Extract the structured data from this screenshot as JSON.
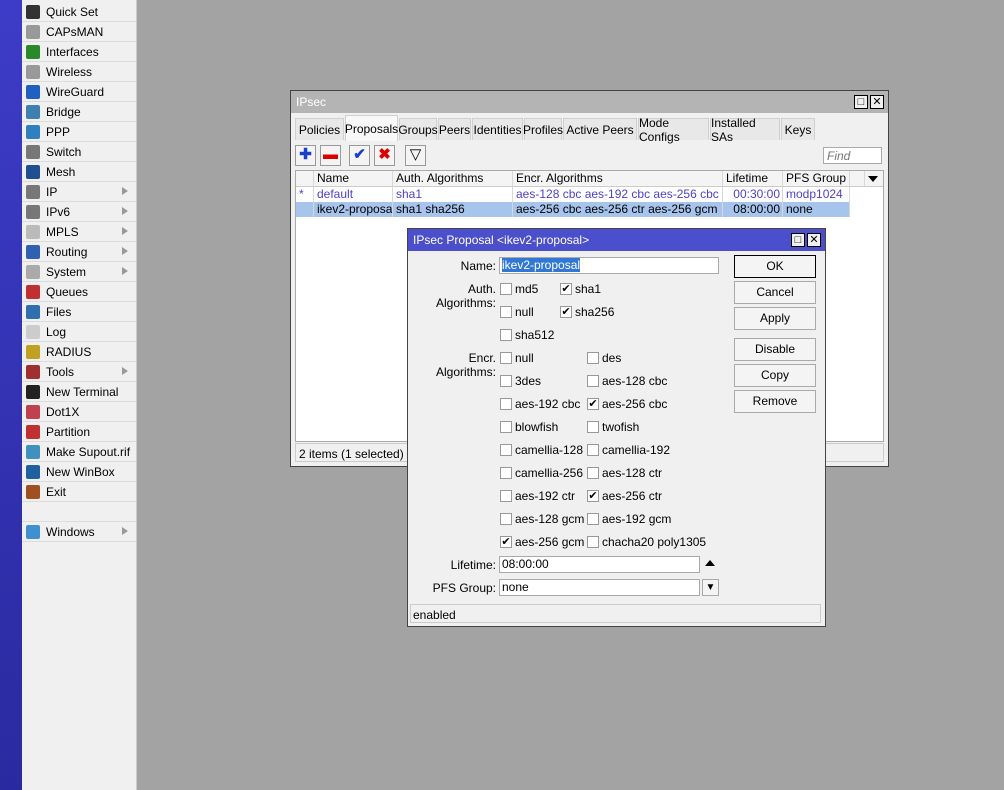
{
  "colors": {
    "accent_blue": "#4b4fcb",
    "selection": "#a7c5ec",
    "link_text": "#4f3fcb"
  },
  "sidebar": {
    "items": [
      {
        "label": "Quick Set",
        "icon": "wand-icon",
        "color": "#333",
        "submenu": false
      },
      {
        "label": "CAPsMAN",
        "icon": "antenna-icon",
        "color": "#999",
        "submenu": false
      },
      {
        "label": "Interfaces",
        "icon": "interface-card-icon",
        "color": "#2a8a2a",
        "submenu": false
      },
      {
        "label": "Wireless",
        "icon": "wireless-icon",
        "color": "#999",
        "submenu": false
      },
      {
        "label": "WireGuard",
        "icon": "wireguard-icon",
        "color": "#2060c0",
        "submenu": false
      },
      {
        "label": "Bridge",
        "icon": "bridge-icon",
        "color": "#4080b0",
        "submenu": false
      },
      {
        "label": "PPP",
        "icon": "ppp-icon",
        "color": "#3080c0",
        "submenu": false
      },
      {
        "label": "Switch",
        "icon": "switch-icon",
        "color": "#777",
        "submenu": false
      },
      {
        "label": "Mesh",
        "icon": "mesh-icon",
        "color": "#205090",
        "submenu": false
      },
      {
        "label": "IP",
        "icon": "ip-icon",
        "color": "#777",
        "submenu": true
      },
      {
        "label": "IPv6",
        "icon": "ipv6-icon",
        "color": "#777",
        "submenu": true
      },
      {
        "label": "MPLS",
        "icon": "mpls-icon",
        "color": "#bbb",
        "submenu": true
      },
      {
        "label": "Routing",
        "icon": "routing-icon",
        "color": "#3060b0",
        "submenu": true
      },
      {
        "label": "System",
        "icon": "gear-icon",
        "color": "#aaa",
        "submenu": true
      },
      {
        "label": "Queues",
        "icon": "queues-icon",
        "color": "#c03030",
        "submenu": false
      },
      {
        "label": "Files",
        "icon": "folder-icon",
        "color": "#3070b0",
        "submenu": false
      },
      {
        "label": "Log",
        "icon": "log-icon",
        "color": "#ccc",
        "submenu": false
      },
      {
        "label": "RADIUS",
        "icon": "radius-icon",
        "color": "#c0a020",
        "submenu": false
      },
      {
        "label": "Tools",
        "icon": "tools-icon",
        "color": "#a03030",
        "submenu": true
      },
      {
        "label": "New Terminal",
        "icon": "terminal-icon",
        "color": "#222",
        "submenu": false
      },
      {
        "label": "Dot1X",
        "icon": "dot1x-icon",
        "color": "#c04050",
        "submenu": false
      },
      {
        "label": "Partition",
        "icon": "partition-icon",
        "color": "#c03030",
        "submenu": false
      },
      {
        "label": "Make Supout.rif",
        "icon": "supout-icon",
        "color": "#4090c0",
        "submenu": false
      },
      {
        "label": "New WinBox",
        "icon": "winbox-icon",
        "color": "#2060a0",
        "submenu": false
      },
      {
        "label": "Exit",
        "icon": "exit-icon",
        "color": "#a05020",
        "submenu": false
      },
      {
        "label": "",
        "icon": "",
        "color": "",
        "submenu": false
      },
      {
        "label": "Windows",
        "icon": "windows-icon",
        "color": "#4090d0",
        "submenu": true
      }
    ]
  },
  "ipsec": {
    "title": "IPsec",
    "tabs": [
      "Policies",
      "Proposals",
      "Groups",
      "Peers",
      "Identities",
      "Profiles",
      "Active Peers",
      "Mode Configs",
      "Installed SAs",
      "Keys"
    ],
    "active_tab": "Proposals",
    "find_placeholder": "Find",
    "columns": [
      "Name",
      "Auth. Algorithms",
      "Encr. Algorithms",
      "Lifetime",
      "PFS Group"
    ],
    "rows": [
      {
        "flag": "*",
        "name": "default",
        "auth": "sha1",
        "encr": "aes-128 cbc aes-192 cbc aes-256 cbc",
        "lifetime": "00:30:00",
        "pfs": "modp1024",
        "selected": false
      },
      {
        "flag": "",
        "name": "ikev2-proposal",
        "auth": "sha1 sha256",
        "encr": "aes-256 cbc aes-256 ctr aes-256 gcm",
        "lifetime": "08:00:00",
        "pfs": "none",
        "selected": true
      }
    ],
    "status": "2 items (1 selected)"
  },
  "dialog": {
    "title": "IPsec Proposal <ikev2-proposal>",
    "name_label": "Name:",
    "name_value": "ikev2-proposal",
    "auth_label": "Auth. Algorithms:",
    "auth": [
      {
        "label": "md5",
        "checked": false
      },
      {
        "label": "sha1",
        "checked": true
      },
      {
        "label": "null",
        "checked": false
      },
      {
        "label": "sha256",
        "checked": true
      },
      {
        "label": "sha512",
        "checked": false
      }
    ],
    "encr_label": "Encr. Algorithms:",
    "encr": [
      {
        "label": "null",
        "checked": false
      },
      {
        "label": "des",
        "checked": false
      },
      {
        "label": "3des",
        "checked": false
      },
      {
        "label": "aes-128 cbc",
        "checked": false
      },
      {
        "label": "aes-192 cbc",
        "checked": false
      },
      {
        "label": "aes-256 cbc",
        "checked": true
      },
      {
        "label": "blowfish",
        "checked": false
      },
      {
        "label": "twofish",
        "checked": false
      },
      {
        "label": "camellia-128",
        "checked": false
      },
      {
        "label": "camellia-192",
        "checked": false
      },
      {
        "label": "camellia-256",
        "checked": false
      },
      {
        "label": "aes-128 ctr",
        "checked": false
      },
      {
        "label": "aes-192 ctr",
        "checked": false
      },
      {
        "label": "aes-256 ctr",
        "checked": true
      },
      {
        "label": "aes-128 gcm",
        "checked": false
      },
      {
        "label": "aes-192 gcm",
        "checked": false
      },
      {
        "label": "aes-256 gcm",
        "checked": true
      },
      {
        "label": "chacha20 poly1305",
        "checked": false
      }
    ],
    "lifetime_label": "Lifetime:",
    "lifetime_value": "08:00:00",
    "pfs_label": "PFS Group:",
    "pfs_value": "none",
    "buttons": [
      "OK",
      "Cancel",
      "Apply",
      "Disable",
      "Copy",
      "Remove"
    ],
    "status": "enabled"
  }
}
